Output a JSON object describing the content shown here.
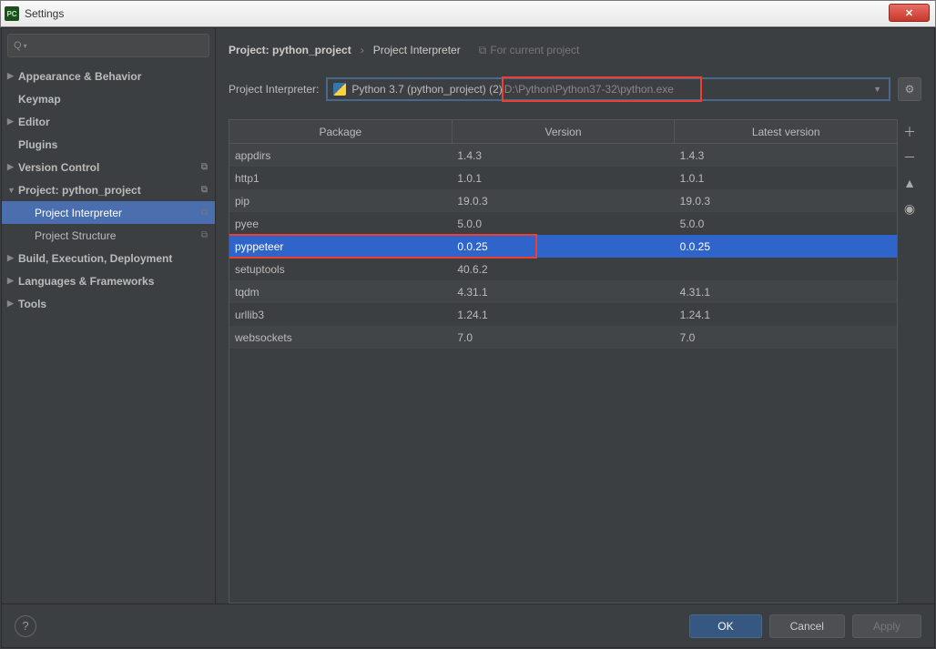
{
  "window": {
    "title": "Settings"
  },
  "breadcrumb": {
    "project": "Project: python_project",
    "page": "Project Interpreter",
    "for_current": "For current project"
  },
  "interpreter": {
    "label": "Project Interpreter:",
    "name": "Python 3.7 (python_project) (2)",
    "path": "D:\\Python\\Python37-32\\python.exe"
  },
  "sidebar": {
    "items": [
      {
        "label": "Appearance & Behavior",
        "bold": true,
        "arrow": "▶"
      },
      {
        "label": "Keymap",
        "bold": true
      },
      {
        "label": "Editor",
        "bold": true,
        "arrow": "▶"
      },
      {
        "label": "Plugins",
        "bold": true
      },
      {
        "label": "Version Control",
        "bold": true,
        "arrow": "▶",
        "copy": true
      },
      {
        "label": "Project: python_project",
        "bold": true,
        "arrow": "▼",
        "copy": true
      },
      {
        "label": "Project Interpreter",
        "child": true,
        "selected": true,
        "copy": true
      },
      {
        "label": "Project Structure",
        "child": true,
        "copy": true
      },
      {
        "label": "Build, Execution, Deployment",
        "bold": true,
        "arrow": "▶"
      },
      {
        "label": "Languages & Frameworks",
        "bold": true,
        "arrow": "▶"
      },
      {
        "label": "Tools",
        "bold": true,
        "arrow": "▶"
      }
    ]
  },
  "table": {
    "headers": {
      "package": "Package",
      "version": "Version",
      "latest": "Latest version"
    },
    "rows": [
      {
        "package": "appdirs",
        "version": "1.4.3",
        "latest": "1.4.3"
      },
      {
        "package": "http1",
        "version": "1.0.1",
        "latest": "1.0.1"
      },
      {
        "package": "pip",
        "version": "19.0.3",
        "latest": "19.0.3"
      },
      {
        "package": "pyee",
        "version": "5.0.0",
        "latest": "5.0.0"
      },
      {
        "package": "pyppeteer",
        "version": "0.0.25",
        "latest": "0.0.25",
        "selected": true
      },
      {
        "package": "setuptools",
        "version": "40.6.2",
        "latest": ""
      },
      {
        "package": "tqdm",
        "version": "4.31.1",
        "latest": "4.31.1"
      },
      {
        "package": "urllib3",
        "version": "1.24.1",
        "latest": "1.24.1"
      },
      {
        "package": "websockets",
        "version": "7.0",
        "latest": "7.0"
      }
    ]
  },
  "buttons": {
    "ok": "OK",
    "cancel": "Cancel",
    "apply": "Apply"
  },
  "search": {
    "placeholder": ""
  }
}
